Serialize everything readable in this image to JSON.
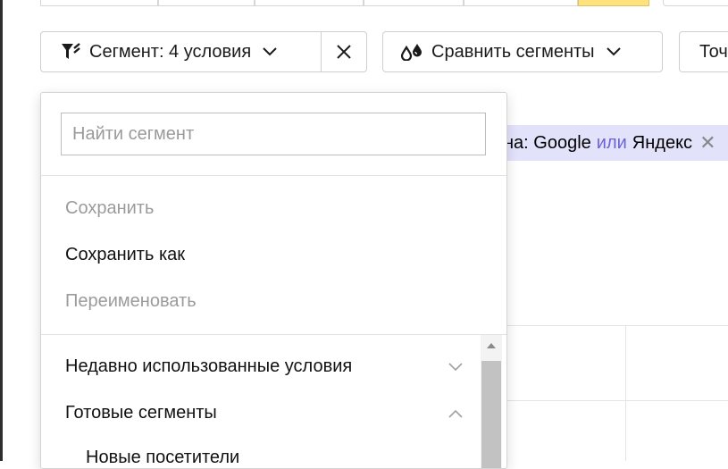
{
  "toolbar": {
    "segment_label": "Сегмент: 4 условия",
    "compare_label": "Сравнить сегменты",
    "truncated_label": "Точ"
  },
  "chip": {
    "prefix": "на: Google",
    "connector": "или",
    "suffix": "Яндекс"
  },
  "dropdown": {
    "search_placeholder": "Найти сегмент",
    "actions": [
      {
        "label": "Сохранить",
        "enabled": false
      },
      {
        "label": "Сохранить как",
        "enabled": true
      },
      {
        "label": "Переименовать",
        "enabled": false
      }
    ],
    "sections": [
      {
        "label": "Недавно использованные условия",
        "expanded": false
      },
      {
        "label": "Готовые сегменты",
        "expanded": true
      }
    ],
    "sub_items": [
      "Новые посетители"
    ]
  },
  "colors": {
    "accent_chip_bg": "#e3e2fb",
    "accent_link": "#6b62d6",
    "active_tab": "#ffe27a"
  },
  "icons": {
    "segment": "filter-icon",
    "clear": "close-icon",
    "compare": "drops-icon",
    "dropdown": "chevron-down-icon"
  }
}
